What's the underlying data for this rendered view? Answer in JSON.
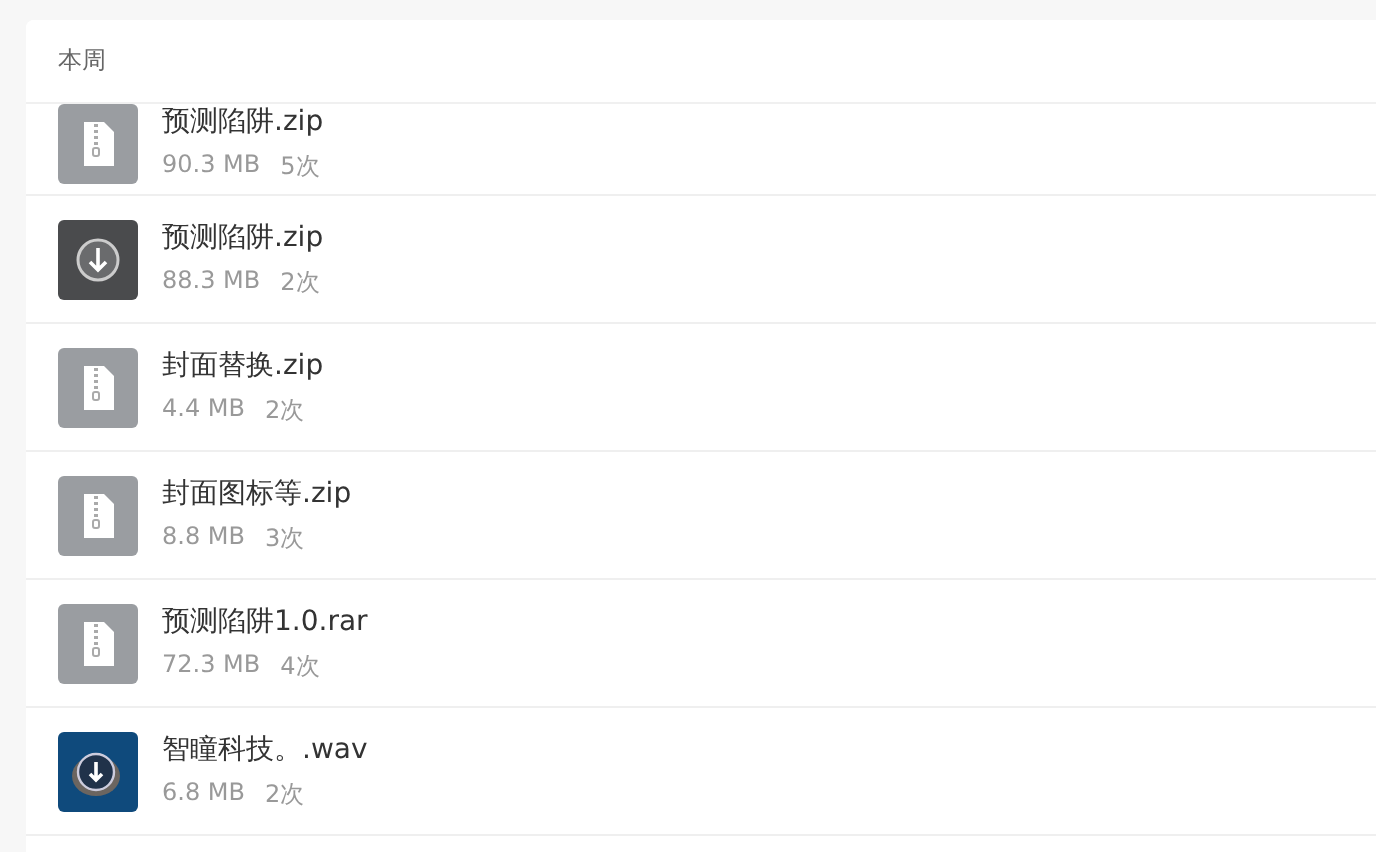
{
  "section": {
    "title": "本周"
  },
  "files": [
    {
      "name": "预测陷阱.zip",
      "size": "90.3 MB",
      "count": "5次",
      "kind": "archive"
    },
    {
      "name": "预测陷阱.zip",
      "size": "88.3 MB",
      "count": "2次",
      "kind": "download"
    },
    {
      "name": "封面替换.zip",
      "size": "4.4 MB",
      "count": "2次",
      "kind": "archive"
    },
    {
      "name": "封面图标等.zip",
      "size": "8.8 MB",
      "count": "3次",
      "kind": "archive"
    },
    {
      "name": "预测陷阱1.0.rar",
      "size": "72.3 MB",
      "count": "4次",
      "kind": "archive"
    },
    {
      "name": "智瞳科技。.wav",
      "size": "6.8 MB",
      "count": "2次",
      "kind": "audio"
    }
  ]
}
